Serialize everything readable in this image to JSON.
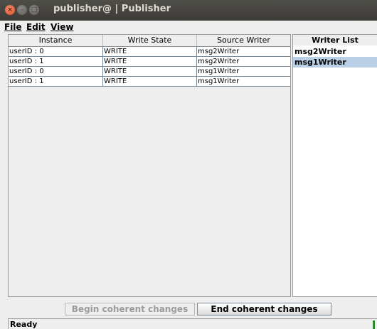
{
  "window": {
    "title": "publisher@ | Publisher",
    "close_glyph": "×",
    "min_glyph": "–",
    "max_glyph": "□"
  },
  "menu": {
    "items": [
      {
        "label": "File"
      },
      {
        "label": "Edit"
      },
      {
        "label": "View"
      }
    ]
  },
  "table": {
    "columns": [
      "Instance",
      "Write State",
      "Source Writer"
    ],
    "rows": [
      [
        "userID : 0",
        "WRITE",
        "msg2Writer"
      ],
      [
        "userID : 1",
        "WRITE",
        "msg2Writer"
      ],
      [
        "userID : 0",
        "WRITE",
        "msg1Writer"
      ],
      [
        "userID : 1",
        "WRITE",
        "msg1Writer"
      ]
    ]
  },
  "writer_list": {
    "header": "Writer List",
    "items": [
      {
        "label": "msg2Writer",
        "selected": false
      },
      {
        "label": "msg1Writer",
        "selected": true
      }
    ],
    "selected_color": "#b8cfe5"
  },
  "buttons": {
    "begin_label": "Begin coherent changes",
    "end_label": "End coherent changes"
  },
  "status": {
    "text": "Ready",
    "indicator_color": "#2e8b2e"
  }
}
